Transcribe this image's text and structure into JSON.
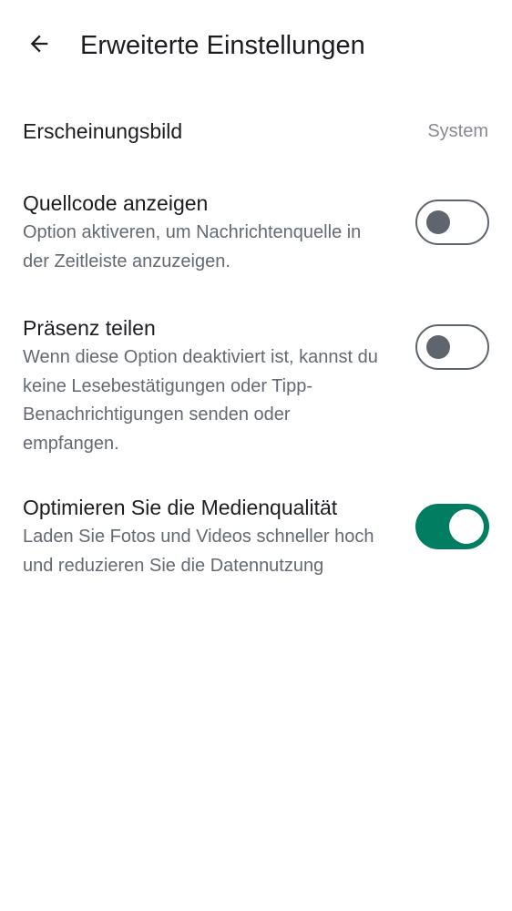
{
  "header": {
    "title": "Erweiterte Einstellungen",
    "back_icon": "arrow-left-icon"
  },
  "appearance": {
    "label": "Erscheinungsbild",
    "value": "System"
  },
  "settings": [
    {
      "title": "Quellcode anzeigen",
      "description": "Option aktiveren, um Nachrichtenquelle in der Zeitleiste anzuzeigen.",
      "enabled": false
    },
    {
      "title": "Präsenz teilen",
      "description": "Wenn diese Option deaktiviert ist, kannst du keine Lesebestätigungen oder Tipp-Benachrichtigungen senden oder empfangen.",
      "enabled": false
    },
    {
      "title": "Optimieren Sie die Medienqualität",
      "description": "Laden Sie Fotos und Videos schneller hoch und reduzieren Sie die Datennutzung",
      "enabled": true
    }
  ],
  "colors": {
    "switch_on": "#017e62",
    "switch_off": "#5f656d",
    "secondary_text": "#646a71",
    "value_text": "#858a91"
  }
}
